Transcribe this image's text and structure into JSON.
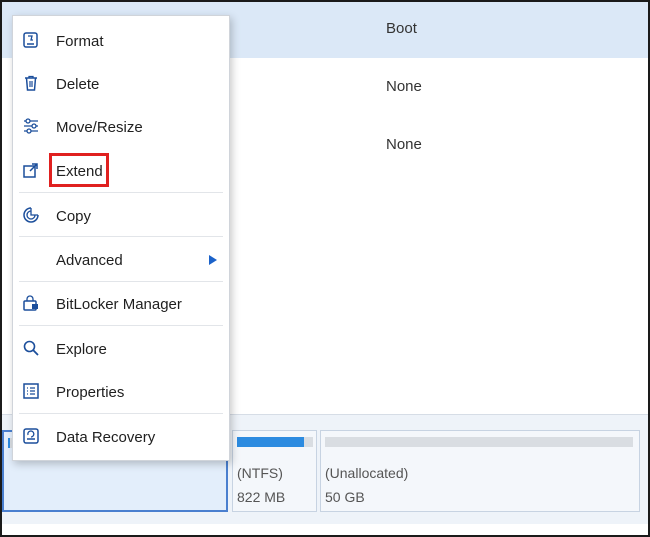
{
  "table": {
    "rows": [
      {
        "file_system": "Boot"
      },
      {
        "file_system": "None"
      },
      {
        "file_system": "None"
      }
    ]
  },
  "diskmap": {
    "partitions": [
      {
        "name": "",
        "size": "",
        "used_fraction": 0.02
      },
      {
        "name": "(NTFS)",
        "size": "822 MB",
        "used_fraction": 0.88
      },
      {
        "name": "(Unallocated)",
        "size": "50 GB",
        "used_fraction": 0.0
      }
    ]
  },
  "context_menu": {
    "items": [
      {
        "label": "Format",
        "icon": "format-disk-icon"
      },
      {
        "label": "Delete",
        "icon": "trash-icon"
      },
      {
        "label": "Move/Resize",
        "icon": "sliders-icon"
      },
      {
        "label": "Extend",
        "icon": "extend-icon",
        "highlighted": true
      },
      {
        "label": "Copy",
        "icon": "copy-icon"
      },
      {
        "label": "Advanced",
        "icon": "",
        "has_submenu": true
      },
      {
        "label": "BitLocker Manager",
        "icon": "bitlocker-icon"
      },
      {
        "label": "Explore",
        "icon": "search-icon"
      },
      {
        "label": "Properties",
        "icon": "properties-icon"
      },
      {
        "label": "Data Recovery",
        "icon": "data-recovery-icon"
      }
    ]
  },
  "colors": {
    "accent": "#1b62c9",
    "highlight_box": "#e0201f",
    "selected_row": "#dbe8f7",
    "bar_fill": "#2c8be0"
  }
}
